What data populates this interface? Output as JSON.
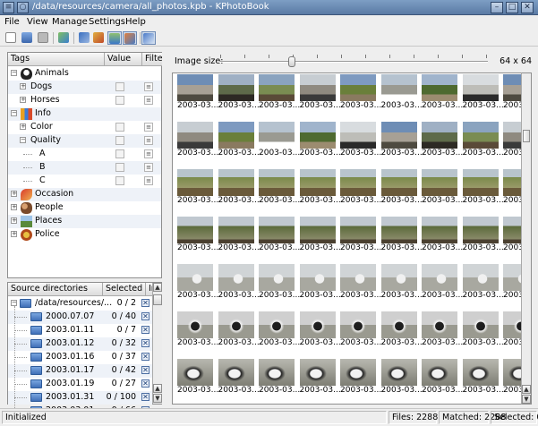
{
  "window": {
    "title": "/data/resources/camera/all_photos.kpb - KPhotoBook"
  },
  "menu": [
    "File",
    "View",
    "Manage",
    "Settings",
    "Help"
  ],
  "toolbar": [
    "new-doc-icon",
    "open-icon",
    "save-icon",
    "edit-icon",
    "tag-icon",
    "brush-icon",
    "source-dir-icon",
    "import-icon",
    "auto-tag-icon"
  ],
  "tags_panel": {
    "headers": [
      "Tags",
      "Value",
      "Filter"
    ],
    "items": [
      {
        "label": "Animals",
        "level": 0,
        "icon": "penguin-icon"
      },
      {
        "label": "Dogs",
        "level": 1,
        "icon": null
      },
      {
        "label": "Horses",
        "level": 1,
        "icon": null
      },
      {
        "label": "Info",
        "level": 0,
        "icon": "chart-icon"
      },
      {
        "label": "Color",
        "level": 1,
        "icon": null
      },
      {
        "label": "Quality",
        "level": 1,
        "icon": null
      },
      {
        "label": "A",
        "level": 2,
        "icon": null
      },
      {
        "label": "B",
        "level": 2,
        "icon": null
      },
      {
        "label": "C",
        "level": 2,
        "icon": null
      },
      {
        "label": "Occasion",
        "level": 0,
        "icon": "rocket-icon"
      },
      {
        "label": "People",
        "level": 0,
        "icon": "people-icon"
      },
      {
        "label": "Places",
        "level": 0,
        "icon": "landscape-icon"
      },
      {
        "label": "Police",
        "level": 0,
        "icon": "badge-icon"
      }
    ]
  },
  "sources_panel": {
    "headers": [
      "Source directories",
      "Selected",
      "In"
    ],
    "rows": [
      {
        "dir": "/data/resources/...",
        "sel": "0 / 2"
      },
      {
        "dir": "2000.07.07",
        "sel": "0 / 40"
      },
      {
        "dir": "2003.01.11",
        "sel": "0 / 7"
      },
      {
        "dir": "2003.01.12",
        "sel": "0 / 32"
      },
      {
        "dir": "2003.01.16",
        "sel": "0 / 37"
      },
      {
        "dir": "2003.01.17",
        "sel": "0 / 42"
      },
      {
        "dir": "2003.01.19",
        "sel": "0 / 27"
      },
      {
        "dir": "2003.01.31",
        "sel": "0 / 100"
      },
      {
        "dir": "2003.03.01",
        "sel": "0 / 66"
      }
    ]
  },
  "image_size": {
    "label": "Image size:",
    "value": "64 x 64",
    "level": 0.27
  },
  "thumbnail_caption": "2003-03...",
  "status": {
    "message": "Initialized",
    "files": "Files: 2288",
    "matched": "Matched: 2288",
    "selected": "Selected: 0"
  }
}
